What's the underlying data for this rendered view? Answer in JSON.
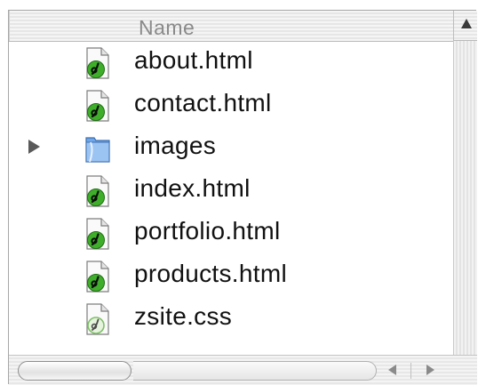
{
  "column_header": {
    "name_label": "Name",
    "sort_direction": "ascending"
  },
  "files": [
    {
      "name": "about.html",
      "type": "html",
      "icon": "dreamweaver-html-icon",
      "expandable": false
    },
    {
      "name": "contact.html",
      "type": "html",
      "icon": "dreamweaver-html-icon",
      "expandable": false
    },
    {
      "name": "images",
      "type": "folder",
      "icon": "folder-icon",
      "expandable": true,
      "expanded": false
    },
    {
      "name": "index.html",
      "type": "html",
      "icon": "dreamweaver-html-icon",
      "expandable": false
    },
    {
      "name": "portfolio.html",
      "type": "html",
      "icon": "dreamweaver-html-icon",
      "expandable": false
    },
    {
      "name": "products.html",
      "type": "html",
      "icon": "dreamweaver-html-icon",
      "expandable": false
    },
    {
      "name": "zsite.css",
      "type": "css",
      "icon": "dreamweaver-css-icon",
      "expandable": false
    }
  ],
  "colors": {
    "html_icon_badge": "#3fae2a",
    "folder": "#6ea6e8",
    "header_text": "#8a8a8a"
  }
}
